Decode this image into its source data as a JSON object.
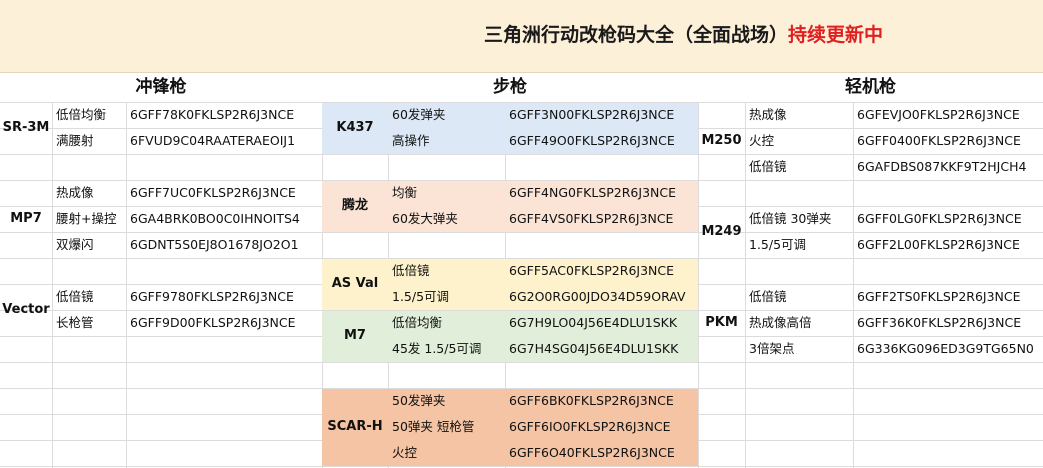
{
  "title": {
    "main": "三角洲行动改枪码大全（全面战场）",
    "highlight": "持续更新中"
  },
  "sections": {
    "smg": "冲锋枪",
    "rifle": "步枪",
    "lmg": "轻机枪"
  },
  "smg": {
    "sr3m": {
      "name": "SR-3M",
      "rows": [
        {
          "label": "低倍均衡",
          "code": "6GFF78K0FKLSP2R6J3NCE"
        },
        {
          "label": "满腰射",
          "code": "6FVUD9C04RAATERAEOIJ1"
        }
      ]
    },
    "mp7": {
      "name": "MP7",
      "rows": [
        {
          "label": "热成像",
          "code": "6GFF7UC0FKLSP2R6J3NCE"
        },
        {
          "label": "腰射+操控",
          "code": "6GA4BRK0BO0C0IHNOITS4"
        },
        {
          "label": "双爆闪",
          "code": "6GDNT5S0EJ8O1678JO2O1"
        }
      ]
    },
    "vector": {
      "name": "Vector",
      "rows": [
        {
          "label": "低倍镜",
          "code": "6GFF9780FKLSP2R6J3NCE"
        },
        {
          "label": "长枪管",
          "code": "6GFF9D00FKLSP2R6J3NCE"
        }
      ]
    }
  },
  "rifle": {
    "k437": {
      "name": "K437",
      "rows": [
        {
          "label": "60发弹夹",
          "code": "6GFF3N00FKLSP2R6J3NCE"
        },
        {
          "label": "高操作",
          "code": "6GFF49O0FKLSP2R6J3NCE"
        }
      ]
    },
    "tenglong": {
      "name": "腾龙",
      "rows": [
        {
          "label": "均衡",
          "code": "6GFF4NG0FKLSP2R6J3NCE"
        },
        {
          "label": "60发大弹夹",
          "code": "6GFF4VS0FKLSP2R6J3NCE"
        }
      ]
    },
    "asval": {
      "name": "AS Val",
      "rows": [
        {
          "label": "低倍镜",
          "code": "6GFF5AC0FKLSP2R6J3NCE"
        },
        {
          "label": "1.5/5可调",
          "code": "6G2O0RG00JDO34D59ORAV"
        }
      ]
    },
    "m7": {
      "name": "M7",
      "rows": [
        {
          "label": "低倍均衡",
          "code": "6G7H9LO04J56E4DLU1SKK"
        },
        {
          "label": "45发 1.5/5可调",
          "code": "6G7H4SG04J56E4DLU1SKK"
        }
      ]
    },
    "scarh": {
      "name": "SCAR-H",
      "rows": [
        {
          "label": "50发弹夹",
          "code": "6GFF6BK0FKLSP2R6J3NCE"
        },
        {
          "label": "50弹夹 短枪管",
          "code": "6GFF6IO0FKLSP2R6J3NCE"
        },
        {
          "label": "火控",
          "code": "6GFF6O40FKLSP2R6J3NCE"
        }
      ]
    }
  },
  "lmg": {
    "m250": {
      "name": "M250",
      "rows": [
        {
          "label": "热成像",
          "code": "6GFEVJO0FKLSP2R6J3NCE"
        },
        {
          "label": "火控",
          "code": "6GFF0400FKLSP2R6J3NCE"
        },
        {
          "label": "低倍镜",
          "code": "6GAFDBS087KKF9T2HJCH4"
        }
      ]
    },
    "m249": {
      "name": "M249",
      "rows": [
        {
          "label": "低倍镜 30弹夹",
          "code": "6GFF0LG0FKLSP2R6J3NCE"
        },
        {
          "label": "1.5/5可调",
          "code": "6GFF2L00FKLSP2R6J3NCE"
        }
      ]
    },
    "pkm": {
      "name": "PKM",
      "rows": [
        {
          "label": "低倍镜",
          "code": "6GFF2TS0FKLSP2R6J3NCE"
        },
        {
          "label": "热成像高倍",
          "code": "6GFF36K0FKLSP2R6J3NCE"
        },
        {
          "label": "3倍架点",
          "code": "6G336KG096ED3G9TG65N0"
        }
      ]
    }
  },
  "colors": {
    "banner": "#fdf0d8",
    "title_red": "#e02020",
    "k437_bg": "#dce8f6",
    "tenglong_bg": "#fbe4d6",
    "asval_bg": "#fdf2cc",
    "m7_bg": "#e1efda",
    "scarh_bg": "#f4c4a4"
  }
}
